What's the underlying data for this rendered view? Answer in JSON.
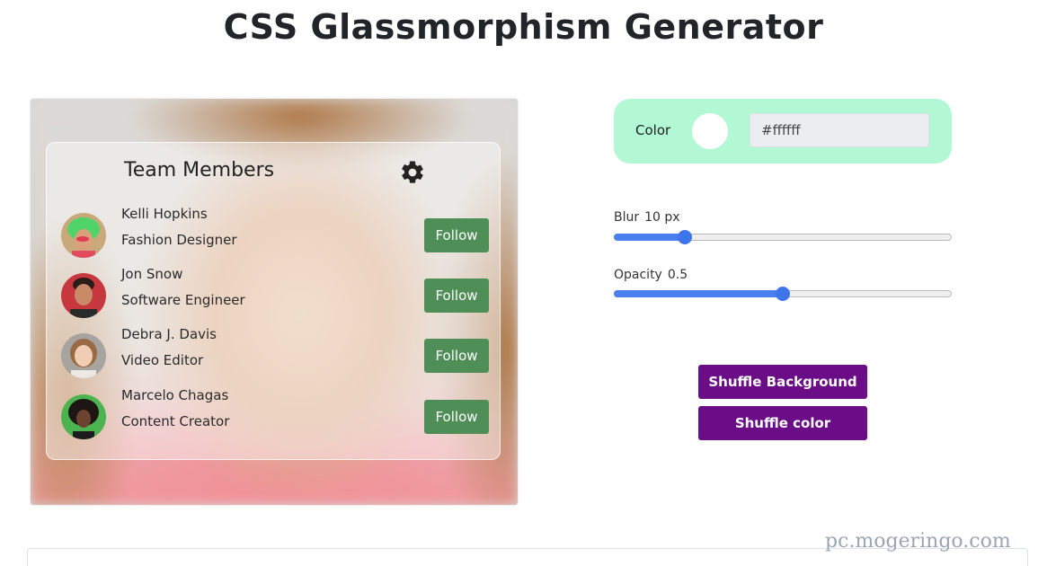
{
  "page": {
    "title": "CSS Glassmorphism Generator"
  },
  "preview": {
    "card_title": "Team Members",
    "settings_icon": "gear-icon",
    "members": [
      {
        "name": "Kelli Hopkins",
        "role": "Fashion Designer",
        "button": "Follow",
        "avatar_icon": "avatar-photo"
      },
      {
        "name": "Jon Snow",
        "role": "Software Engineer",
        "button": "Follow",
        "avatar_icon": "avatar-photo"
      },
      {
        "name": "Debra J. Davis",
        "role": "Video Editor",
        "button": "Follow",
        "avatar_icon": "avatar-photo"
      },
      {
        "name": "Marcelo Chagas",
        "role": "Content Creator",
        "button": "Follow",
        "avatar_icon": "avatar-photo"
      }
    ]
  },
  "controls": {
    "color": {
      "label": "Color",
      "value": "#ffffff",
      "swatch": "#ffffff"
    },
    "blur": {
      "label": "Blur",
      "value_text": "10 px",
      "value": 10,
      "fraction": 0.21
    },
    "opacity": {
      "label": "Opacity",
      "value_text": "0.5",
      "value": 0.5,
      "fraction": 0.5
    },
    "shuffle_background": "Shuffle Background",
    "shuffle_color": "Shuffle color"
  },
  "watermark": "pc.mogeringo.com",
  "colors": {
    "panel": "#b3f8d4",
    "follow": "#4f8f57",
    "action": "#6a0d86",
    "slider": "#4a7ff0"
  }
}
